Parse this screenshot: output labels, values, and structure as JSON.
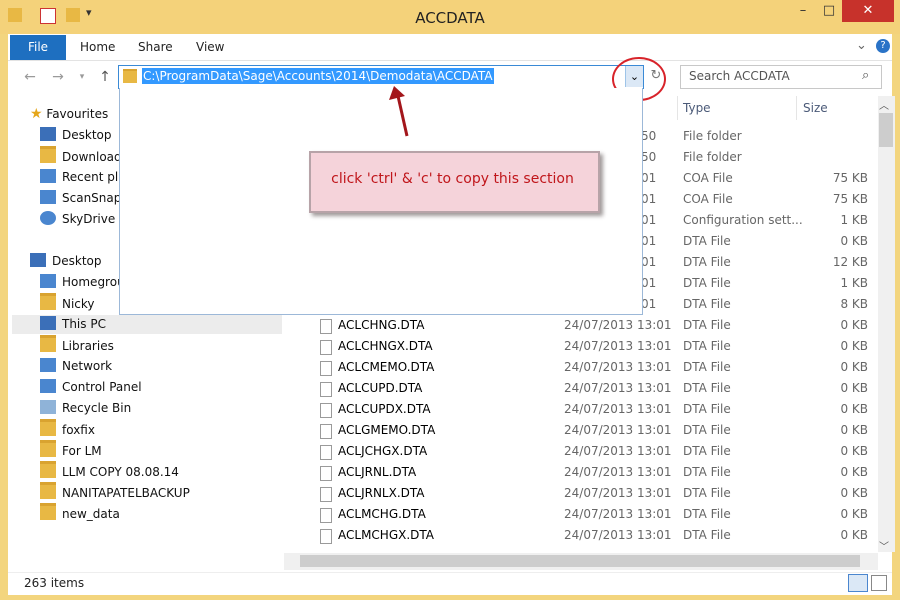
{
  "window": {
    "title": "ACCDATA",
    "min": "–",
    "max": "□",
    "close": "✕"
  },
  "ribbon": {
    "tabs": [
      "File",
      "Home",
      "Share",
      "View"
    ],
    "help": "?",
    "expand": "⌄"
  },
  "nav": {
    "back": "←",
    "forward": "→",
    "up": "↑"
  },
  "address": {
    "path": "C:\\ProgramData\\Sage\\Accounts\\2014\\Demodata\\ACCDATA",
    "dropdown": "⌄",
    "refresh": "↻"
  },
  "search": {
    "placeholder": "Search ACCDATA"
  },
  "callout": {
    "text": "click 'ctrl' & 'c' to copy this section"
  },
  "sidebar": {
    "favourites": "Favourites",
    "favourite_items": [
      "Desktop",
      "Downloads",
      "Recent plac",
      "ScanSnap F",
      "SkyDrive"
    ],
    "desktop": "Desktop",
    "desktop_items": [
      "Homegrou",
      "Nicky",
      "This PC",
      "Libraries",
      "Network",
      "Control Panel",
      "Recycle Bin",
      "foxfix",
      "For LM",
      "LLM COPY 08.08.14",
      "NANITAPATELBACKUP",
      "new_data"
    ]
  },
  "columns": {
    "type": "Type",
    "size": "Size"
  },
  "partial_rows": [
    {
      "date": "50",
      "type": "File folder",
      "size": ""
    },
    {
      "date": "50",
      "type": "File folder",
      "size": ""
    },
    {
      "date": "01",
      "type": "COA File",
      "size": "75 KB"
    },
    {
      "date": "01",
      "type": "COA File",
      "size": "75 KB"
    },
    {
      "date": "01",
      "type": "Configuration sett...",
      "size": "1 KB"
    },
    {
      "date": "01",
      "type": "DTA File",
      "size": "0 KB"
    },
    {
      "date": "01",
      "type": "DTA File",
      "size": "12 KB"
    },
    {
      "date": "01",
      "type": "DTA File",
      "size": "1 KB"
    },
    {
      "date": "01",
      "type": "DTA File",
      "size": "8 KB"
    }
  ],
  "rows": [
    {
      "name": "ACLCHNG.DTA",
      "date": "24/07/2013 13:01",
      "type": "DTA File",
      "size": "0 KB"
    },
    {
      "name": "ACLCHNGX.DTA",
      "date": "24/07/2013 13:01",
      "type": "DTA File",
      "size": "0 KB"
    },
    {
      "name": "ACLCMEMO.DTA",
      "date": "24/07/2013 13:01",
      "type": "DTA File",
      "size": "0 KB"
    },
    {
      "name": "ACLCUPD.DTA",
      "date": "24/07/2013 13:01",
      "type": "DTA File",
      "size": "0 KB"
    },
    {
      "name": "ACLCUPDX.DTA",
      "date": "24/07/2013 13:01",
      "type": "DTA File",
      "size": "0 KB"
    },
    {
      "name": "ACLGMEMO.DTA",
      "date": "24/07/2013 13:01",
      "type": "DTA File",
      "size": "0 KB"
    },
    {
      "name": "ACLJCHGX.DTA",
      "date": "24/07/2013 13:01",
      "type": "DTA File",
      "size": "0 KB"
    },
    {
      "name": "ACLJRNL.DTA",
      "date": "24/07/2013 13:01",
      "type": "DTA File",
      "size": "0 KB"
    },
    {
      "name": "ACLJRNLX.DTA",
      "date": "24/07/2013 13:01",
      "type": "DTA File",
      "size": "0 KB"
    },
    {
      "name": "ACLMCHG.DTA",
      "date": "24/07/2013 13:01",
      "type": "DTA File",
      "size": "0 KB"
    },
    {
      "name": "ACLMCHGX.DTA",
      "date": "24/07/2013 13:01",
      "type": "DTA File",
      "size": "0 KB"
    }
  ],
  "status": {
    "count": "263 items"
  }
}
